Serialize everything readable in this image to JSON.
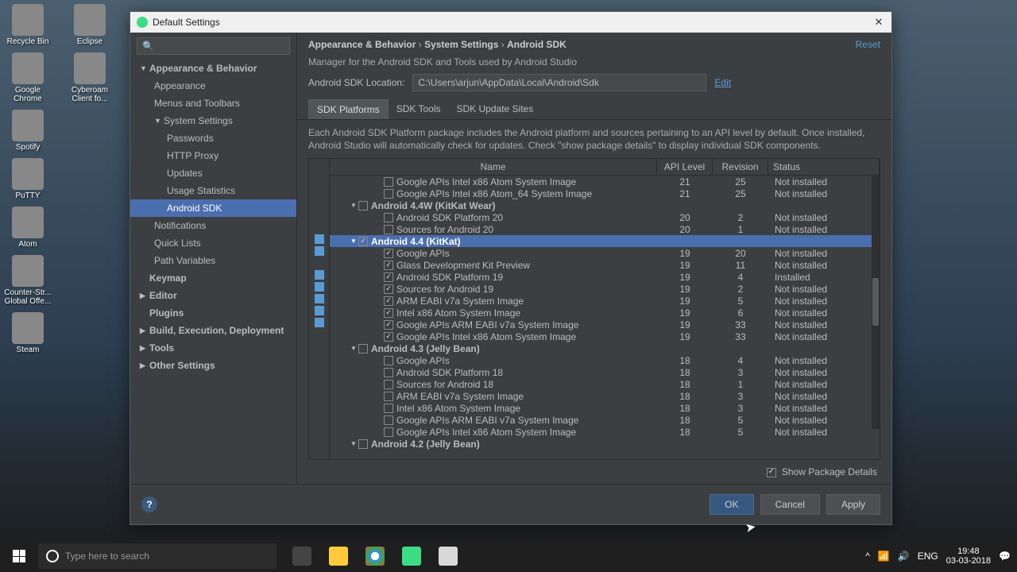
{
  "desktop": {
    "icons": [
      [
        {
          "label": "Recycle Bin"
        },
        {
          "label": "Eclipse"
        }
      ],
      [
        {
          "label": "Google Chrome"
        },
        {
          "label": "Cyberoam Client fo..."
        }
      ],
      [
        {
          "label": "Spotify"
        }
      ],
      [
        {
          "label": "PuTTY"
        }
      ],
      [
        {
          "label": "Atom"
        }
      ],
      [
        {
          "label": "Counter-Str... Global Offe..."
        }
      ],
      [
        {
          "label": "Steam"
        }
      ]
    ]
  },
  "dialog": {
    "title": "Default Settings",
    "breadcrumb": {
      "a": "Appearance & Behavior",
      "b": "System Settings",
      "c": "Android SDK",
      "reset": "Reset"
    },
    "subtitle": "Manager for the Android SDK and Tools used by Android Studio",
    "location": {
      "label": "Android SDK Location:",
      "value": "C:\\Users\\arjun\\AppData\\Local\\Android\\Sdk",
      "edit": "Edit"
    },
    "tabs": {
      "platforms": "SDK Platforms",
      "tools": "SDK Tools",
      "sites": "SDK Update Sites"
    },
    "tab_desc": "Each Android SDK Platform package includes the Android platform and sources pertaining to an API level by default. Once installed, Android Studio will automatically check for updates. Check \"show package details\" to display individual SDK components.",
    "columns": {
      "name": "Name",
      "api": "API Level",
      "rev": "Revision",
      "status": "Status"
    },
    "show_pkg": "Show Package Details",
    "buttons": {
      "ok": "OK",
      "cancel": "Cancel",
      "apply": "Apply"
    }
  },
  "sidebar": [
    {
      "label": "Appearance & Behavior",
      "level": 1,
      "exp": true
    },
    {
      "label": "Appearance",
      "level": 2
    },
    {
      "label": "Menus and Toolbars",
      "level": 2
    },
    {
      "label": "System Settings",
      "level": 2,
      "exp": true
    },
    {
      "label": "Passwords",
      "level": 3
    },
    {
      "label": "HTTP Proxy",
      "level": 3
    },
    {
      "label": "Updates",
      "level": 3
    },
    {
      "label": "Usage Statistics",
      "level": 3
    },
    {
      "label": "Android SDK",
      "level": 3,
      "selected": true
    },
    {
      "label": "Notifications",
      "level": 2
    },
    {
      "label": "Quick Lists",
      "level": 2
    },
    {
      "label": "Path Variables",
      "level": 2
    },
    {
      "label": "Keymap",
      "level": 1
    },
    {
      "label": "Editor",
      "level": 1,
      "arrow": true
    },
    {
      "label": "Plugins",
      "level": 1
    },
    {
      "label": "Build, Execution, Deployment",
      "level": 1,
      "arrow": true
    },
    {
      "label": "Tools",
      "level": 1,
      "arrow": true
    },
    {
      "label": "Other Settings",
      "level": 1,
      "arrow": true
    }
  ],
  "rows": [
    {
      "indent": 3,
      "check": false,
      "name": "Google APIs Intel x86 Atom System Image",
      "api": "21",
      "rev": "25",
      "status": "Not installed"
    },
    {
      "indent": 3,
      "check": false,
      "name": "Google APIs Intel x86 Atom_64 System Image",
      "api": "21",
      "rev": "25",
      "status": "Not installed"
    },
    {
      "indent": 1,
      "arrow": true,
      "check": false,
      "name": "Android 4.4W (KitKat Wear)",
      "bold": true
    },
    {
      "indent": 3,
      "check": false,
      "name": "Android SDK Platform 20",
      "api": "20",
      "rev": "2",
      "status": "Not installed"
    },
    {
      "indent": 3,
      "check": false,
      "name": "Sources for Android 20",
      "api": "20",
      "rev": "1",
      "status": "Not installed"
    },
    {
      "indent": 1,
      "arrow": true,
      "check": true,
      "name": "Android 4.4 (KitKat)",
      "bold": true,
      "selected": true
    },
    {
      "indent": 3,
      "check": true,
      "name": "Google APIs",
      "api": "19",
      "rev": "20",
      "status": "Not installed"
    },
    {
      "indent": 3,
      "check": true,
      "name": "Glass Development Kit Preview",
      "api": "19",
      "rev": "11",
      "status": "Not installed"
    },
    {
      "indent": 3,
      "check": true,
      "name": "Android SDK Platform 19",
      "api": "19",
      "rev": "4",
      "status": "Installed"
    },
    {
      "indent": 3,
      "check": true,
      "name": "Sources for Android 19",
      "api": "19",
      "rev": "2",
      "status": "Not installed"
    },
    {
      "indent": 3,
      "check": true,
      "name": "ARM EABI v7a System Image",
      "api": "19",
      "rev": "5",
      "status": "Not installed"
    },
    {
      "indent": 3,
      "check": true,
      "name": "Intel x86 Atom System Image",
      "api": "19",
      "rev": "6",
      "status": "Not installed"
    },
    {
      "indent": 3,
      "check": true,
      "name": "Google APIs ARM EABI v7a System Image",
      "api": "19",
      "rev": "33",
      "status": "Not installed"
    },
    {
      "indent": 3,
      "check": true,
      "name": "Google APIs Intel x86 Atom System Image",
      "api": "19",
      "rev": "33",
      "status": "Not installed"
    },
    {
      "indent": 1,
      "arrow": true,
      "check": false,
      "name": "Android 4.3 (Jelly Bean)",
      "bold": true
    },
    {
      "indent": 3,
      "check": false,
      "name": "Google APIs",
      "api": "18",
      "rev": "4",
      "status": "Not installed"
    },
    {
      "indent": 3,
      "check": false,
      "name": "Android SDK Platform 18",
      "api": "18",
      "rev": "3",
      "status": "Not installed"
    },
    {
      "indent": 3,
      "check": false,
      "name": "Sources for Android 18",
      "api": "18",
      "rev": "1",
      "status": "Not installed"
    },
    {
      "indent": 3,
      "check": false,
      "name": "ARM EABI v7a System Image",
      "api": "18",
      "rev": "3",
      "status": "Not installed"
    },
    {
      "indent": 3,
      "check": false,
      "name": "Intel x86 Atom System Image",
      "api": "18",
      "rev": "3",
      "status": "Not installed"
    },
    {
      "indent": 3,
      "check": false,
      "name": "Google APIs ARM EABI v7a System Image",
      "api": "18",
      "rev": "5",
      "status": "Not installed"
    },
    {
      "indent": 3,
      "check": false,
      "name": "Google APIs Intel x86 Atom System Image",
      "api": "18",
      "rev": "5",
      "status": "Not installed"
    },
    {
      "indent": 1,
      "arrow": true,
      "check": false,
      "name": "Android 4.2 (Jelly Bean)",
      "bold": true
    }
  ],
  "taskbar": {
    "search_placeholder": "Type here to search",
    "lang": "ENG",
    "time": "19:48",
    "date": "03-03-2018"
  }
}
